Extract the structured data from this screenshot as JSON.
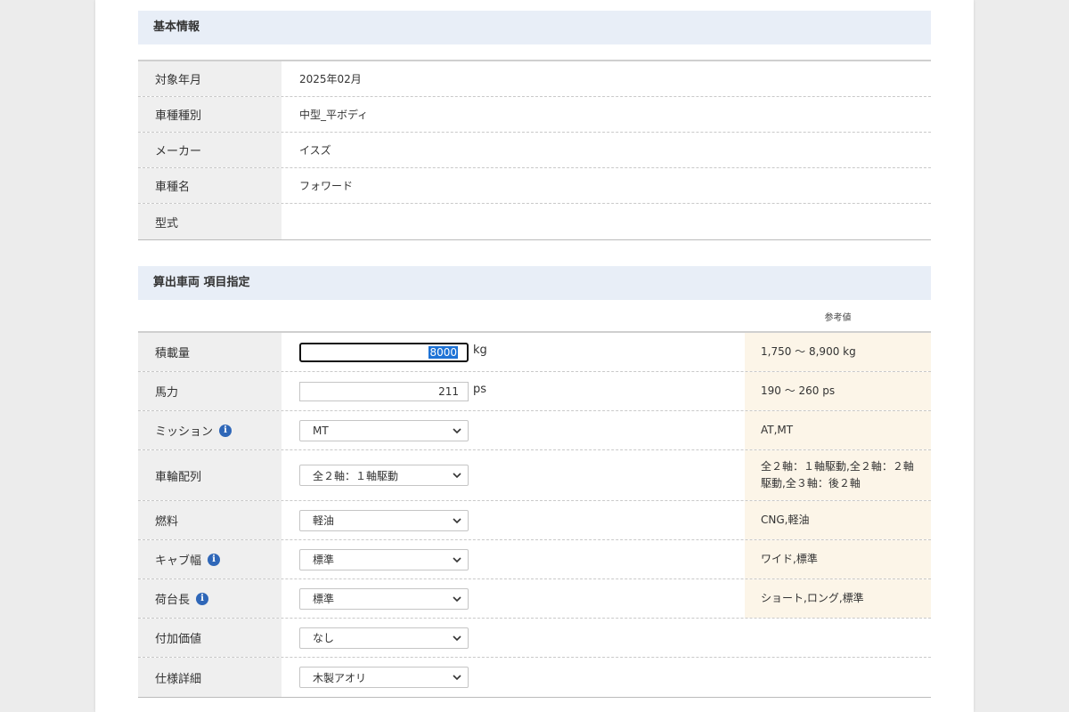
{
  "basic": {
    "title": "基本情報",
    "rows": [
      {
        "label": "対象年月",
        "value": "2025年02月"
      },
      {
        "label": "車種種別",
        "value": "中型_平ボディ"
      },
      {
        "label": "メーカー",
        "value": "イスズ"
      },
      {
        "label": "車種名",
        "value": "フォワード"
      },
      {
        "label": "型式",
        "value": ""
      }
    ]
  },
  "calc": {
    "title": "算出車両 項目指定",
    "ref_header": "参考値",
    "load": {
      "label": "積載量",
      "value": "8000",
      "unit": "kg",
      "ref": "1,750 〜 8,900 kg"
    },
    "power": {
      "label": "馬力",
      "value": "211",
      "unit": "ps",
      "ref": "190 〜 260 ps"
    },
    "mission": {
      "label": "ミッション",
      "value": "MT",
      "ref": "AT,MT"
    },
    "wheel": {
      "label": "車輪配列",
      "value": "全２軸：１軸駆動",
      "ref": "全２軸：１軸駆動,全２軸：２軸駆動,全３軸：後２軸"
    },
    "fuel": {
      "label": "燃料",
      "value": "軽油",
      "ref": "CNG,軽油"
    },
    "cab": {
      "label": "キャブ幅",
      "value": "標準",
      "ref": "ワイド,標準"
    },
    "bed": {
      "label": "荷台長",
      "value": "標準",
      "ref": "ショート,ロング,標準"
    },
    "addon": {
      "label": "付加価値",
      "value": "なし"
    },
    "spec": {
      "label": "仕様詳細",
      "value": "木製アオリ"
    }
  },
  "icons": {
    "info": "info-icon",
    "dropdown": "chevron-down-icon"
  },
  "colors": {
    "section_bg": "#e8eef7",
    "label_bg": "#efefef",
    "ref_bg": "#fcf5e8",
    "info_icon": "#2f67b8",
    "selection": "#1e73d6"
  }
}
